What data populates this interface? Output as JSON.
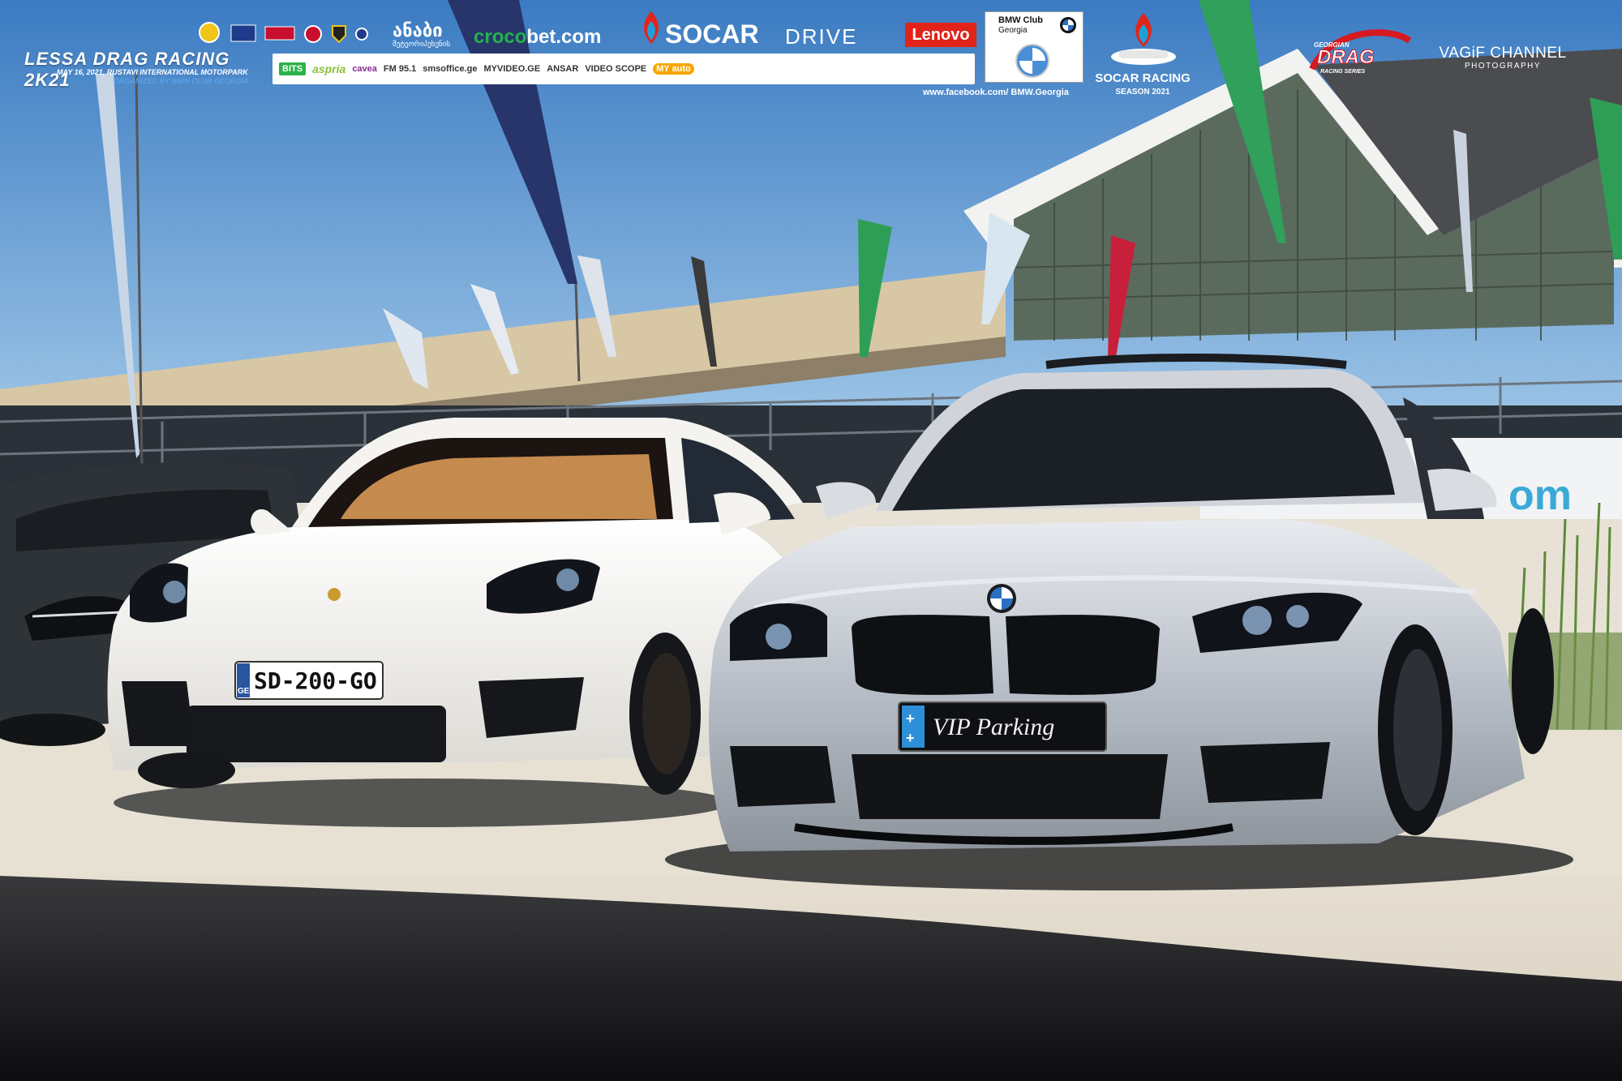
{
  "event": {
    "title": "LESSA DRAG RACING 2K21",
    "date_line": "MAY 16, 2021, RUSTAVI INTERNATIONAL MOTORPARK",
    "organizer_line": "ORGANIZED BY BMW CLUB GEORGIA"
  },
  "sponsors": {
    "top_row": [
      "Drift",
      "FIA",
      "RASF",
      "ანაბი",
      "crocobet.com",
      "SOCAR",
      "DRIVE",
      "Lenovo"
    ],
    "georgian_brand": "ანაბი",
    "georgian_brand_sub": "მეტეორიპეხენის",
    "crocobet_prefix": "croco",
    "crocobet_suffix": "bet.com",
    "socar": "SOCAR",
    "drive": "DRIVE",
    "lenovo": "Lenovo",
    "bar_items": [
      "BITS",
      "aspria",
      "cavea",
      "FM 95.1",
      "smsoffice.ge",
      "MYVIDEO.GE",
      "ANSAR",
      "VIDEO SCOPE",
      "MY auto"
    ],
    "bits": "BITS",
    "aspria": "aspria",
    "cavea": "cavea",
    "fm": "FM 95.1",
    "smsoffice": "smsoffice.ge",
    "myvideo": "MYVIDEO.GE",
    "ansar": "ANSAR",
    "videoscope": "VIDEO SCOPE",
    "myauto": "MY auto"
  },
  "bmw_club": {
    "line1": "BMW Club",
    "line2": "Georgia",
    "facebook": "www.facebook.com/ BMW.Georgia"
  },
  "socar_racing": {
    "title": "SOCAR RACING",
    "season": "SEASON 2021"
  },
  "drag_series": {
    "top": "GEORGIAN",
    "main": "DRAG",
    "bottom": "RACING SERIES"
  },
  "photographer": {
    "name": "VAGiF CHANNEL",
    "sub": "PHOTOGRAPHY"
  },
  "cars": {
    "porsche_plate": "SD-200-GO",
    "porsche_plate_country": "GE",
    "bmw_plate": "VIP Parking"
  },
  "colors": {
    "sky_top": "#3f7fc4",
    "sky_bottom": "#8cbbe2",
    "ground": "#e3dccd",
    "shadow": "#14161a",
    "bmw_silver": "#c9ced6",
    "porsche_white": "#f4f3ef",
    "banner_green": "#2e9e56"
  }
}
